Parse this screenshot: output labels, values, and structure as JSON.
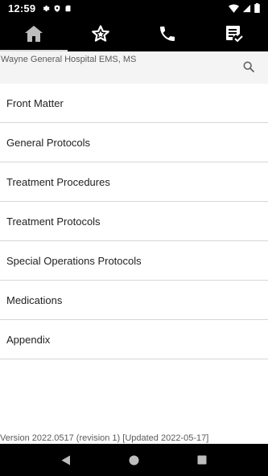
{
  "status_bar": {
    "time": "12:59",
    "left_icons": [
      "gear-icon",
      "shield-icon",
      "sd-card-icon"
    ],
    "right_icons": [
      "wifi-icon",
      "signal-icon",
      "battery-icon"
    ]
  },
  "toolbar": {
    "tabs": [
      {
        "icon": "home-icon"
      },
      {
        "icon": "star-icon"
      },
      {
        "icon": "phone-icon"
      },
      {
        "icon": "checklist-icon"
      }
    ],
    "active_index": 0
  },
  "header": {
    "hospital_name": "Wayne General Hospital EMS, MS",
    "search_icon": "search-icon"
  },
  "menu": {
    "items": [
      {
        "label": "Front Matter"
      },
      {
        "label": "General Protocols"
      },
      {
        "label": "Treatment Procedures"
      },
      {
        "label": "Treatment Protocols"
      },
      {
        "label": "Special Operations Protocols"
      },
      {
        "label": "Medications"
      },
      {
        "label": "Appendix"
      }
    ]
  },
  "footer": {
    "version": "Version 2022.0517 (revision 1) [Updated 2022-05-17]"
  },
  "nav_bar": {
    "buttons": [
      "back-icon",
      "home-circle-icon",
      "recents-icon"
    ]
  }
}
